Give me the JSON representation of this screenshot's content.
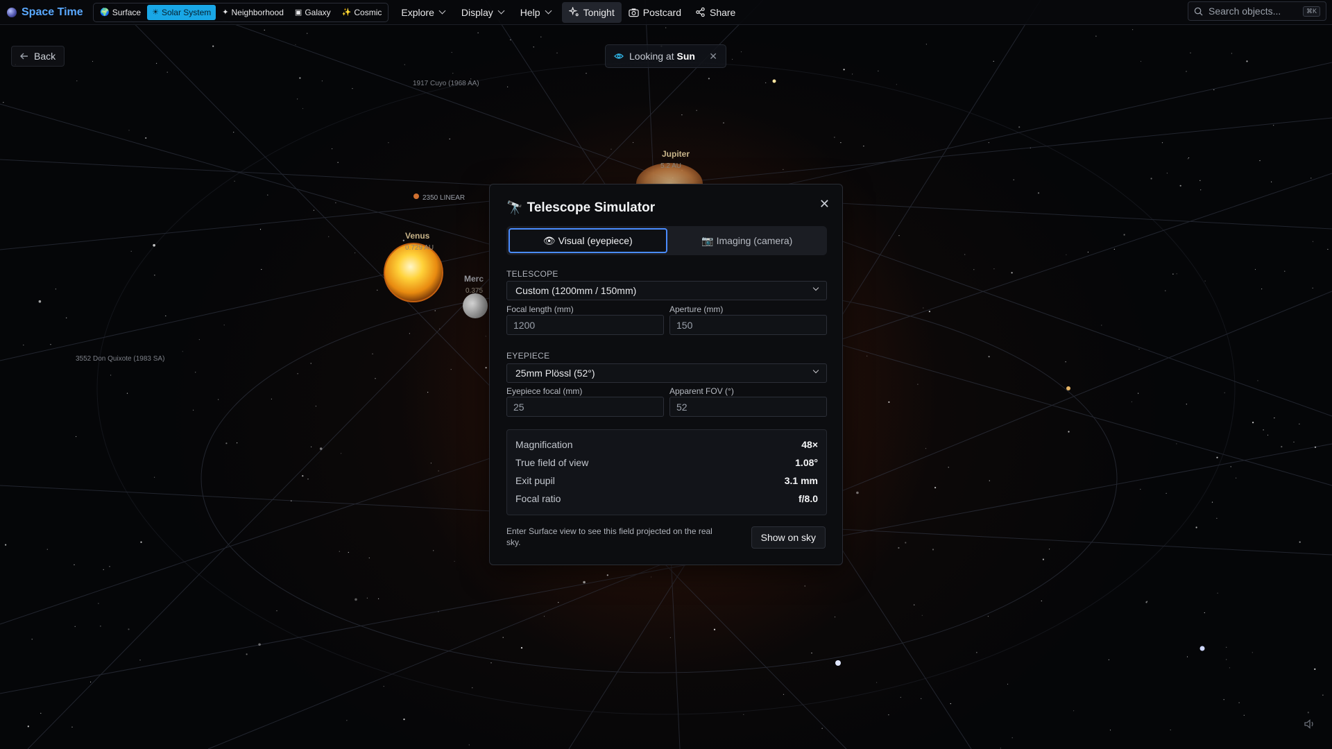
{
  "app": {
    "name": "Space Time"
  },
  "modes": [
    {
      "id": "surface",
      "icon": "🌍",
      "label": "Surface",
      "active": false
    },
    {
      "id": "solar",
      "icon": "☀",
      "label": "Solar System",
      "active": true
    },
    {
      "id": "neighborhood",
      "icon": "✦",
      "label": "Neighborhood",
      "active": false
    },
    {
      "id": "galaxy",
      "icon": "▣",
      "label": "Galaxy",
      "active": false
    },
    {
      "id": "cosmic",
      "icon": "✨",
      "label": "Cosmic",
      "active": false
    }
  ],
  "menus": {
    "explore": "Explore",
    "display": "Display",
    "help": "Help"
  },
  "actions": {
    "tonight": "Tonight",
    "postcard": "Postcard",
    "share": "Share"
  },
  "search": {
    "placeholder": "Search objects...",
    "shortcut": "⌘K"
  },
  "back": "Back",
  "looking": {
    "prefix": "Looking at",
    "target": "Sun"
  },
  "sky_labels": {
    "cuyo": "1917 Cuyo (1968 AA)",
    "quixote": "3552 Don Quixote (1983 SA)",
    "linear": "2350 LINEAR",
    "venus": "Venus",
    "venus_dist": "0.729 AU",
    "mercury": "Merc",
    "mercury_dist": "0.375",
    "jupiter": "Jupiter",
    "jupiter_dist": "5.2 AU"
  },
  "modal": {
    "title": "Telescope Simulator",
    "tabs": [
      {
        "icon": "👁",
        "label": "Visual (eyepiece)",
        "active": true
      },
      {
        "icon": "📷",
        "label": "Imaging (camera)",
        "active": false
      }
    ],
    "telescope": {
      "section": "TELESCOPE",
      "selected": "Custom (1200mm / 150mm)",
      "focal_label": "Focal length (mm)",
      "focal_value": "1200",
      "aperture_label": "Aperture (mm)",
      "aperture_value": "150"
    },
    "eyepiece": {
      "section": "EYEPIECE",
      "selected": "25mm Plössl (52°)",
      "focal_label": "Eyepiece focal (mm)",
      "focal_value": "25",
      "fov_label": "Apparent FOV (°)",
      "fov_value": "52"
    },
    "stats": [
      {
        "key": "Magnification",
        "value": "48×"
      },
      {
        "key": "True field of view",
        "value": "1.08°"
      },
      {
        "key": "Exit pupil",
        "value": "3.1 mm"
      },
      {
        "key": "Focal ratio",
        "value": "f/8.0"
      }
    ],
    "note": "Enter Surface view to see this field projected on the real sky.",
    "show_button": "Show on sky"
  },
  "colors": {
    "accent": "#19a7e6",
    "brand": "#5aa9ff",
    "focus": "#4a8cff"
  }
}
